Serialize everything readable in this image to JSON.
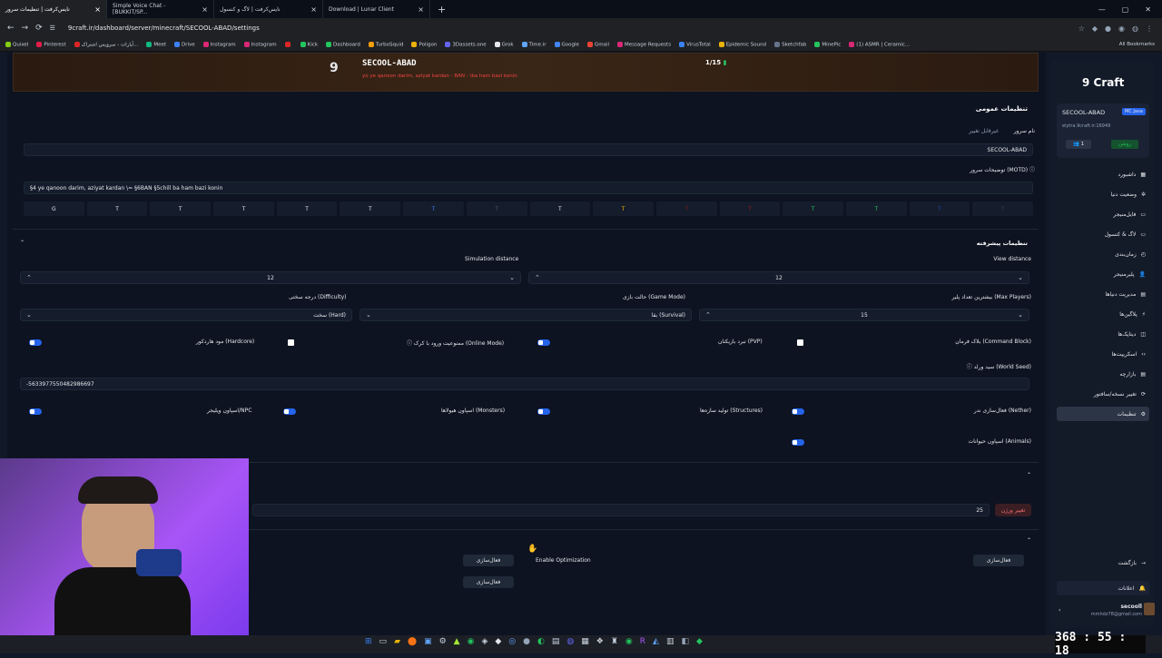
{
  "browser": {
    "tabs": [
      {
        "title": "نایس‌کرفت | تنظیمات سرور",
        "active": true
      },
      {
        "title": "Simple Voice Chat - [BUKKIT/SP..."
      },
      {
        "title": "نایس‌کرفت | لاگ و کنسول"
      },
      {
        "title": "Download | Lunar Client"
      }
    ],
    "url": "9craft.ir/dashboard/server/minecraft/SECOOL-ABAD/settings",
    "bookmarks": [
      "Quixel",
      "Pinterest",
      "آپارات - سرویس اشتراک...",
      "Meet",
      "Drive",
      "Instagram",
      "Instagram",
      "",
      "Kick",
      "Dashboard",
      "TurboSquid",
      "Poligon",
      "3Dassets.one",
      "Grok",
      "Time.ir",
      "Google",
      "Gmail",
      "Message Requests",
      "VirusTotal",
      "Epidemic Sound",
      "Sketchfab",
      "MinePic",
      "(1) ASMR | Ceramic..."
    ],
    "all_bookmarks": "All Bookmarks"
  },
  "banner": {
    "server_name": "SECOOL-ABAD",
    "motd_line": "yo ye qanoon darim, aziyat kardan - BAN - \\ba ham bazi konin",
    "motd_ban": "BAN",
    "players": "1/15"
  },
  "general": {
    "title": "تنظیمات عمومی",
    "server_name_label": "نام سرور",
    "server_name_note": "غیرقابل تغییر",
    "server_name_value": "SECOOL-ABAD",
    "motd_label": "توضیحات سرور (MOTD)",
    "motd_value": "§4 ye qanoon darim, aziyat kardan \\= §6BAN §5chill ba ham bazi konin",
    "format_buttons": [
      "G",
      "T",
      "T",
      "T",
      "T",
      "T",
      "T",
      "T",
      "T",
      "T",
      "T",
      "T",
      "T",
      "T",
      "T",
      "T"
    ]
  },
  "advanced": {
    "title": "تنظیمات پیشرفته",
    "simulation_distance_label": "Simulation distance",
    "simulation_distance_value": "12",
    "view_distance_label": "View distance",
    "view_distance_value": "12",
    "difficulty_label": "درجه سختی (Difficulty)",
    "difficulty_value": "سخت (Hard)",
    "gamemode_label": "حالت بازی (Game Mode)",
    "gamemode_value": "بقا (Survival)",
    "max_players_label": "بیشترین تعداد پلیر (Max Players)",
    "max_players_value": "15",
    "hardcore_label": "مود هاردکور (Hardcore)",
    "online_mode_label": "ممنوعیت ورود با کرک (Online Mode)",
    "pvp_label": "نبرد بازیکنان (PVP)",
    "command_block_label": "بلاک فرمان (Command Block)",
    "world_seed_label": "سید ورلد (World Seed)",
    "world_seed_value": "-5633977550482986697",
    "npc_label": "اسپاون ویلیجر/NPC",
    "monsters_label": "اسپاون هیولاها (Monsters)",
    "structures_label": "تولید سازه‌ها (Structures)",
    "nether_label": "فعال‌سازی ندر (Nether)",
    "animals_label": "اسپاون حیوانات (Animals)"
  },
  "version": {
    "value": "25",
    "change_label": "تغییر ورژن"
  },
  "optimization": {
    "enable_label": "Enable Optimization",
    "activate_1": "فعال‌سازی",
    "activate_2": "فعال‌سازی",
    "activate_3": "فعال‌سازی"
  },
  "sidebar": {
    "brand": "Craft",
    "server_name": "SECOOL-ABAD",
    "edition": "MC Java",
    "address": "elytra.9craft.ir:16949",
    "online_count": "1",
    "status": "روشن",
    "items": [
      "داشبورد",
      "وضعیت دنیا",
      "فایل‌منیجر",
      "لاگ & کنسول",
      "زمان‌بندی",
      "پلیرمنیجر",
      "مدیریت دنیاها",
      "پلاگین‌ها",
      "دیتاپک‌ها",
      "اسکریپت‌ها",
      "بازارچه",
      "تغییر نسخه/سافتور",
      "تنظیمات"
    ],
    "back": "بازگشت",
    "notifications": "اعلانات",
    "user_name": "secooll",
    "user_email": "mmhdz78@gmail.com"
  },
  "clock": "368 : 55 : 18",
  "colors": {
    "accent": "#2563eb",
    "bg": "#0d1321",
    "sidebar": "#131a28",
    "green": "#22c55e"
  }
}
